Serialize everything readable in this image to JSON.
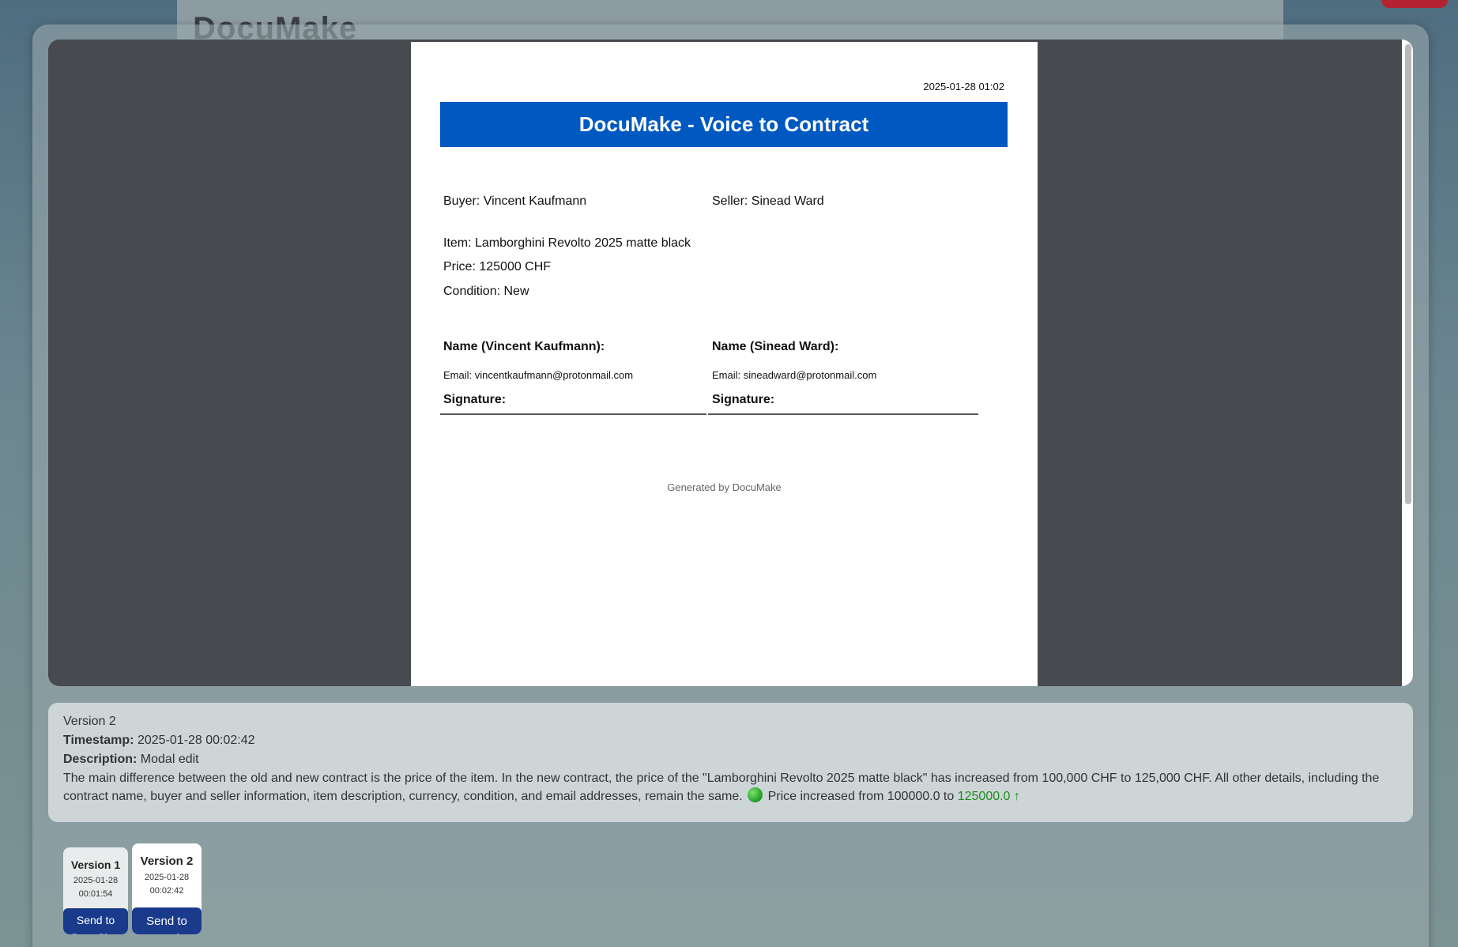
{
  "background_app": {
    "title": "DocuMake"
  },
  "pdf": {
    "timestamp": "2025-01-28 01:02",
    "header": "DocuMake - Voice to Contract",
    "buyer": "Buyer: Vincent Kaufmann",
    "seller": "Seller: Sinead Ward",
    "item": "Item: Lamborghini Revolto 2025 matte black",
    "price": "Price: 125000 CHF",
    "condition": "Condition: New",
    "buyer_name": "Name (Vincent Kaufmann):",
    "seller_name": "Name (Sinead Ward):",
    "buyer_email": "Email: vincentkaufmann@protonmail.com",
    "seller_email": "Email: sineadward@protonmail.com",
    "buyer_signature": "Signature:",
    "seller_signature": "Signature:",
    "footer": "Generated by DocuMake"
  },
  "info": {
    "version": "Version 2",
    "timestamp_label": "Timestamp:",
    "timestamp_value": "2025-01-28 00:02:42",
    "description_label": "Description:",
    "description_value": "Modal edit",
    "summary": "The main difference between the old and new contract is the price of the item. In the new contract, the price of the \"Lamborghini Revolto 2025 matte black\" has increased from 100,000 CHF to 125,000 CHF. All other details, including the contract name, buyer and seller information, item description, currency, condition, and email addresses, remain the same.",
    "change_text": "Price increased from ",
    "old_value": "100000.0",
    "change_to": " to ",
    "new_value": "125000.0 ↑"
  },
  "versions": [
    {
      "title": "Version 1",
      "date": "2025-01-28",
      "time": "00:01:54",
      "button": "Send to DocuSign"
    },
    {
      "title": "Version 2",
      "date": "2025-01-28",
      "time": "00:02:42",
      "button": "Send to DocuSign"
    }
  ],
  "colors": {
    "header_blue": "#0059c1",
    "button_blue": "#1a3a8c",
    "increase_green": "#1f8a1f"
  }
}
